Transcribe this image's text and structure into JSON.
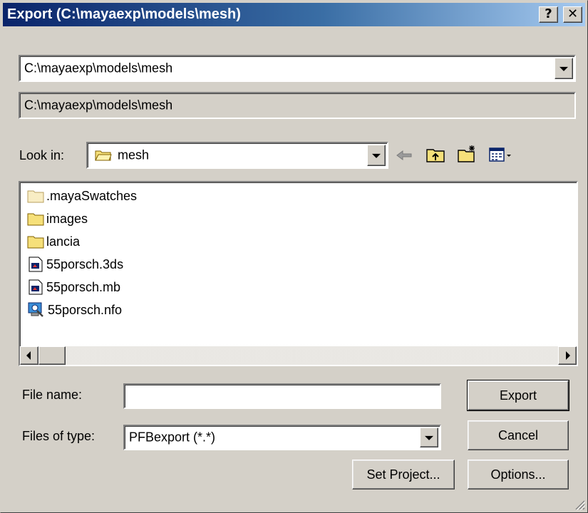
{
  "window": {
    "title": "Export (C:\\mayaexp\\models\\mesh)",
    "help_label": "?",
    "close_label": "✕"
  },
  "path_combo": {
    "value": "C:\\mayaexp\\models\\mesh"
  },
  "path_display": {
    "value": "C:\\mayaexp\\models\\mesh"
  },
  "look_in": {
    "label": "Look in:",
    "value": "mesh"
  },
  "toolbar_icons": [
    "back-arrow-icon",
    "up-folder-icon",
    "new-folder-icon",
    "view-menu-icon"
  ],
  "file_list": {
    "items": [
      {
        "name": ".mayaSwatches",
        "icon": "folder-light-icon"
      },
      {
        "name": "images",
        "icon": "folder-icon"
      },
      {
        "name": "lancia",
        "icon": "folder-icon"
      },
      {
        "name": "55porsch.3ds",
        "icon": "maya-file-icon"
      },
      {
        "name": "55porsch.mb",
        "icon": "maya-file-icon"
      },
      {
        "name": "55porsch.nfo",
        "icon": "system-info-icon"
      }
    ]
  },
  "file_name": {
    "label": "File name:",
    "value": ""
  },
  "file_type": {
    "label": "Files of type:",
    "value": "PFBexport (*.*)"
  },
  "buttons": {
    "export": "Export",
    "cancel": "Cancel",
    "set_project": "Set Project...",
    "options": "Options..."
  },
  "colors": {
    "dialog_bg": "#d4d0c8",
    "title_gradient_start": "#0a246a",
    "title_gradient_end": "#a6caf0",
    "folder_yellow": "#f6e07a"
  }
}
